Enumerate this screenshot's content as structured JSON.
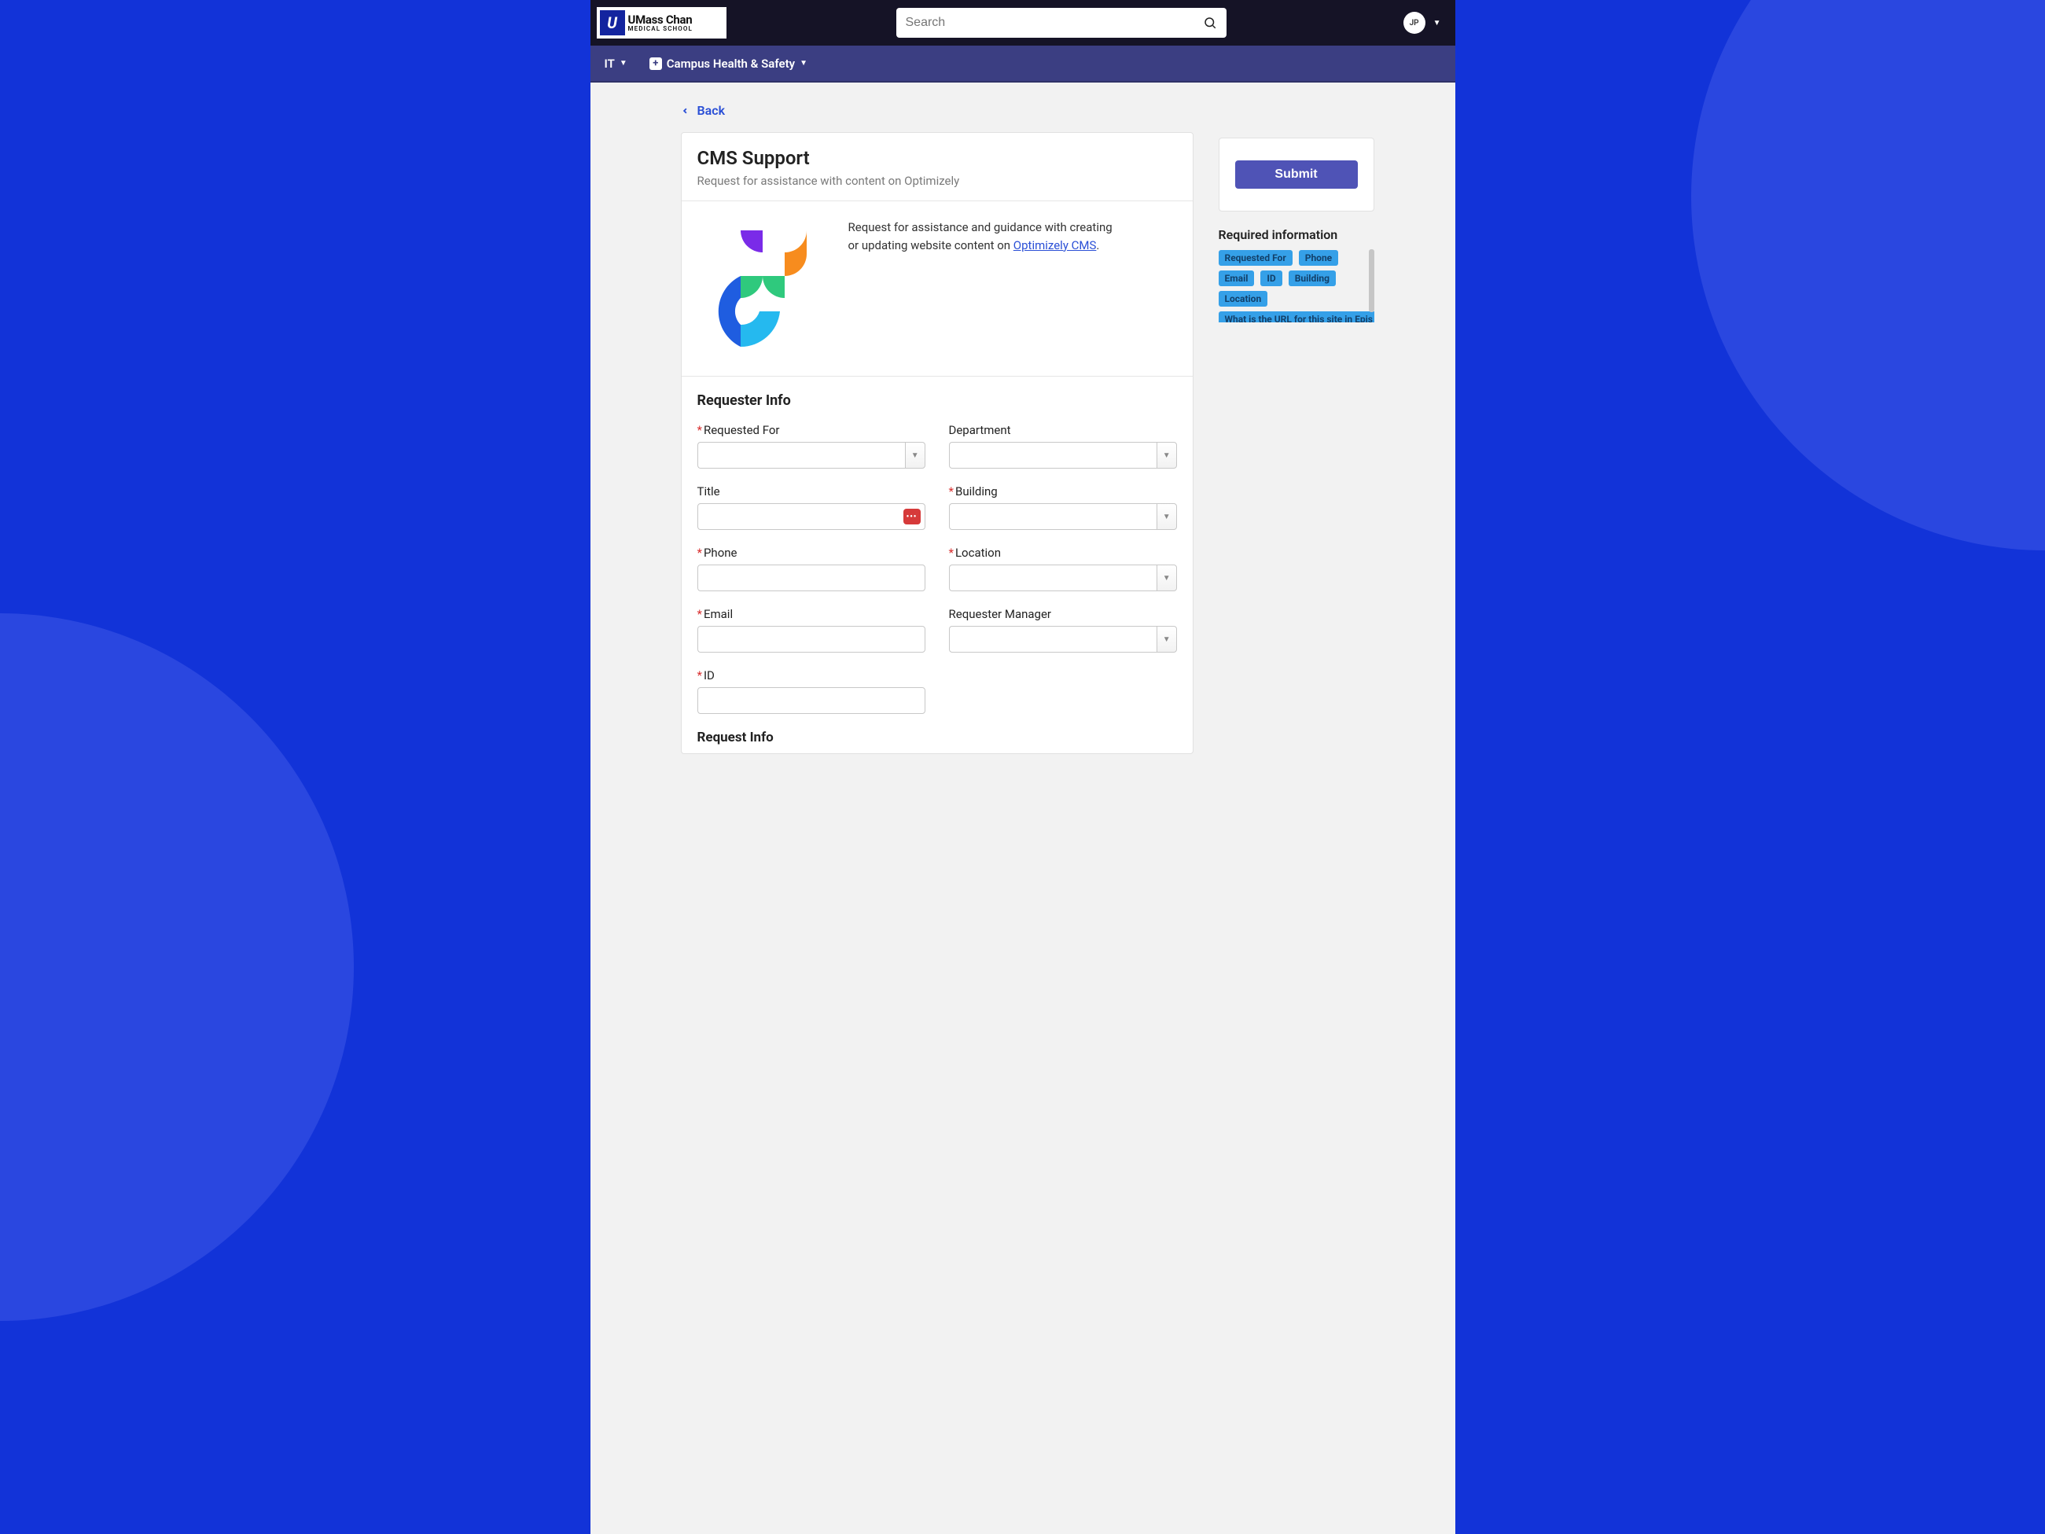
{
  "logo": {
    "main": "UMass Chan",
    "sub": "MEDICAL SCHOOL",
    "mark": "U"
  },
  "search": {
    "placeholder": "Search"
  },
  "user": {
    "initials": "JP"
  },
  "nav": {
    "item1": "IT",
    "item2": "Campus Health & Safety"
  },
  "back": "Back",
  "page": {
    "title": "CMS Support",
    "subtitle": "Request for assistance with content on Optimizely",
    "desc_pre": "Request for assistance and guidance with creating or updating website content on ",
    "desc_link": "Optimizely CMS",
    "desc_post": "."
  },
  "form": {
    "section1": "Requester Info",
    "requested_for": "Requested For",
    "department": "Department",
    "title": "Title",
    "building": "Building",
    "phone": "Phone",
    "location": "Location",
    "email": "Email",
    "requester_manager": "Requester Manager",
    "id": "ID",
    "section2": "Request Info"
  },
  "submit": "Submit",
  "required": {
    "title": "Required information",
    "tags": [
      "Requested For",
      "Phone",
      "Email",
      "ID",
      "Building",
      "Location",
      "What is the URL for this site in Epis"
    ]
  },
  "input_badge": "•••"
}
